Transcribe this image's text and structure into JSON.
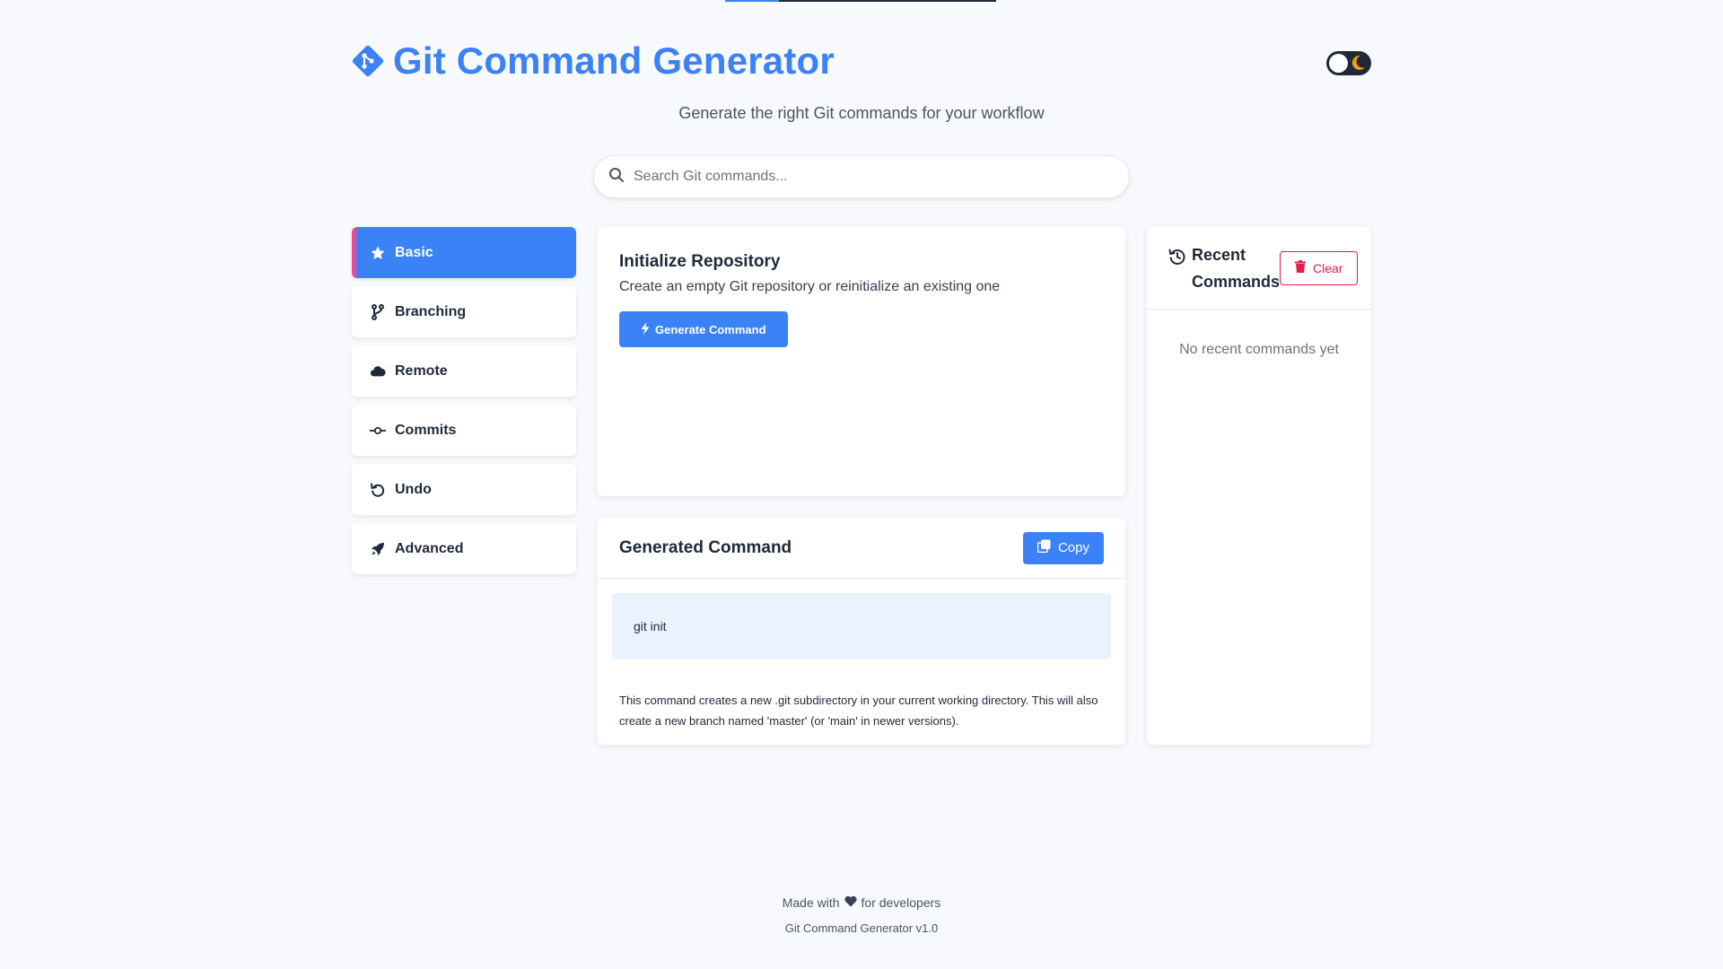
{
  "app": {
    "title": "Git Command Generator",
    "subtitle": "Generate the right Git commands for your workflow",
    "accent_color": "#3b82f6",
    "highlight_color": "#ec4899",
    "progress": 0.2
  },
  "search": {
    "placeholder": "Search Git commands..."
  },
  "categories": [
    {
      "label": "Basic",
      "icon": "star-icon",
      "active": true
    },
    {
      "label": "Branching",
      "icon": "branch-icon",
      "active": false
    },
    {
      "label": "Remote",
      "icon": "cloud-icon",
      "active": false
    },
    {
      "label": "Commits",
      "icon": "commit-icon",
      "active": false
    },
    {
      "label": "Undo",
      "icon": "undo-icon",
      "active": false
    },
    {
      "label": "Advanced",
      "icon": "rocket-icon",
      "active": false
    }
  ],
  "command_card": {
    "title": "Initialize Repository",
    "description": "Create an empty Git repository or reinitialize an existing one",
    "generate_label": "Generate Command"
  },
  "generated": {
    "title": "Generated Command",
    "copy_label": "Copy",
    "command": "git init",
    "explanation": "This command creates a new .git subdirectory in your current working directory. This will also create a new branch named 'master' (or 'main' in newer versions)."
  },
  "recent": {
    "title_line1": "Recent",
    "title_line2": "Commands",
    "clear_label": "Clear",
    "empty_text": "No recent commands yet"
  },
  "footer": {
    "made_prefix": "Made with",
    "made_suffix": "for developers",
    "version": "Git Command Generator v1.0"
  }
}
